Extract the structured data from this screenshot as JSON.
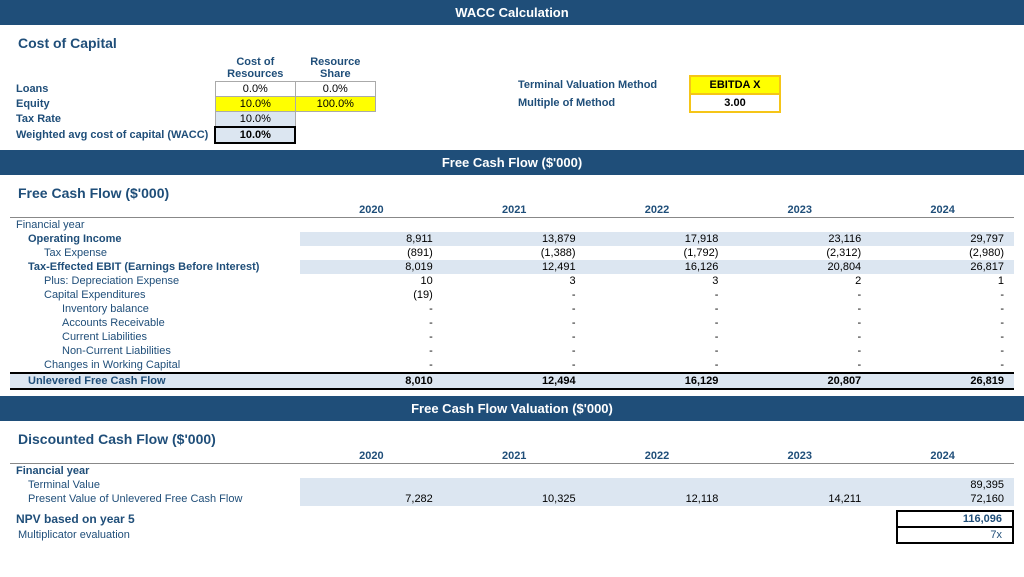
{
  "page": {
    "main_title": "WACC Calculation",
    "wacc": {
      "section_title": "Cost of Capital",
      "col_headers": [
        "Cost of Resources",
        "Resource Share"
      ],
      "rows": [
        {
          "label": "Loans",
          "cost": "0.0%",
          "share": "0.0%",
          "cost_bg": "",
          "share_bg": ""
        },
        {
          "label": "Equity",
          "cost": "10.0%",
          "share": "100.0%",
          "cost_bg": "bg-yellow",
          "share_bg": "bg-yellow"
        },
        {
          "label": "Tax Rate",
          "cost": "10.0%",
          "share": "",
          "cost_bg": "bg-light",
          "share_bg": ""
        },
        {
          "label": "Weighted avg cost of capital (WACC)",
          "cost": "10.0%",
          "share": "",
          "cost_bg": "bold-val",
          "share_bg": ""
        }
      ],
      "terminal_label": "Terminal Valuation Method",
      "terminal_value": "EBITDA X",
      "multiple_label": "Multiple of Method",
      "multiple_value": "3.00"
    },
    "fcf": {
      "section_title": "Free Cash Flow ($'000)",
      "subsection_title": "Free Cash Flow ($'000)",
      "years": [
        "2020",
        "2021",
        "2022",
        "2023",
        "2024"
      ],
      "rows": [
        {
          "label": "Financial year",
          "is_header": true,
          "indent": 0,
          "vals": [
            "",
            "",
            "",
            "",
            ""
          ],
          "shaded": false
        },
        {
          "label": "Operating Income",
          "is_bold": true,
          "indent": 1,
          "vals": [
            "8,911",
            "13,879",
            "17,918",
            "23,116",
            "29,797"
          ],
          "shaded": true
        },
        {
          "label": "Tax Expense",
          "indent": 2,
          "vals": [
            "(891)",
            "(1,388)",
            "(1,792)",
            "(2,312)",
            "(2,980)"
          ],
          "shaded": false
        },
        {
          "label": "Tax-Effected EBIT (Earnings Before Interest)",
          "is_bold": true,
          "indent": 1,
          "vals": [
            "8,019",
            "12,491",
            "16,126",
            "20,804",
            "26,817"
          ],
          "shaded": true
        },
        {
          "label": "Plus: Depreciation Expense",
          "indent": 2,
          "vals": [
            "10",
            "3",
            "3",
            "2",
            "1"
          ],
          "shaded": false
        },
        {
          "label": "Capital Expenditures",
          "indent": 2,
          "vals": [
            "(19)",
            "-",
            "-",
            "-",
            "-"
          ],
          "shaded": false
        },
        {
          "label": "Inventory balance",
          "indent": 3,
          "vals": [
            "-",
            "-",
            "-",
            "-",
            "-"
          ],
          "shaded": false
        },
        {
          "label": "Accounts Receivable",
          "indent": 3,
          "vals": [
            "-",
            "-",
            "-",
            "-",
            "-"
          ],
          "shaded": false
        },
        {
          "label": "Current Liabilities",
          "indent": 3,
          "vals": [
            "-",
            "-",
            "-",
            "-",
            "-"
          ],
          "shaded": false
        },
        {
          "label": "Non-Current Liabilities",
          "indent": 3,
          "vals": [
            "-",
            "-",
            "-",
            "-",
            "-"
          ],
          "shaded": false
        },
        {
          "label": "Changes in Working Capital",
          "indent": 2,
          "vals": [
            "-",
            "-",
            "-",
            "-",
            "-"
          ],
          "shaded": false
        },
        {
          "label": "Unlevered Free Cash Flow",
          "is_total": true,
          "indent": 1,
          "vals": [
            "8,010",
            "12,494",
            "16,129",
            "20,807",
            "26,819"
          ],
          "shaded": true
        }
      ]
    },
    "valuation": {
      "section_title": "Free Cash Flow Valuation ($'000)",
      "subsection_title": "Discounted Cash Flow ($'000)",
      "years": [
        "2020",
        "2021",
        "2022",
        "2023",
        "2024"
      ],
      "rows": [
        {
          "label": "Financial year",
          "is_header": true,
          "indent": 0,
          "vals": [
            "",
            "",
            "",
            "",
            ""
          ]
        },
        {
          "label": "Terminal Value",
          "indent": 1,
          "vals": [
            "",
            "",
            "",
            "",
            "89,395"
          ],
          "shaded": true
        },
        {
          "label": "Present Value of Unlevered Free Cash Flow",
          "indent": 1,
          "vals": [
            "7,282",
            "10,325",
            "12,118",
            "14,211",
            "72,160"
          ],
          "shaded": true
        }
      ],
      "npv_label": "NPV based on year 5",
      "npv_value": "116,096",
      "mult_label": "Multiplicator evaluation",
      "mult_value": "7x"
    }
  }
}
